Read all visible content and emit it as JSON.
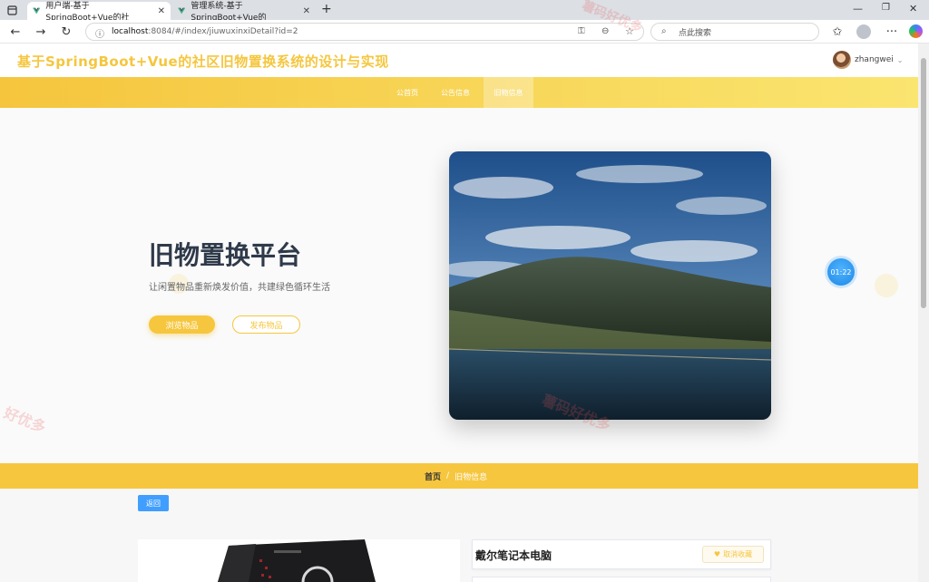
{
  "browser": {
    "tabs": [
      {
        "label": "用户端-基于SpringBoot+Vue的社",
        "active": true
      },
      {
        "label": "管理系统-基于SpringBoot+Vue的",
        "active": false
      }
    ],
    "url_host": "localhost",
    "url_path": ":8084/#/index/jiuwuxinxiDetail?id=2",
    "search_placeholder": "点此搜索",
    "new_tab": "+"
  },
  "header": {
    "site_title": "基于SpringBoot+Vue的社区旧物置换系统的设计与实现",
    "username": "zhangwei"
  },
  "nav": {
    "items": [
      {
        "label": "公首页",
        "active": false
      },
      {
        "label": "公告信息",
        "active": false
      },
      {
        "label": "旧物信息",
        "active": true
      }
    ]
  },
  "hero": {
    "title": "旧物置换平台",
    "subtitle": "让闲置物品重新焕发价值，共建绿色循环生活",
    "browse_label": "浏览物品",
    "publish_label": "发布物品"
  },
  "timer": "01:22",
  "watermarks": [
    "薯码好优多",
    "薯码好优多",
    "好优多"
  ],
  "breadcrumb": {
    "home": "首页",
    "separator": "/",
    "current": "旧物信息"
  },
  "detail": {
    "back_label": "返回",
    "item_title": "戴尔笔记本电脑",
    "unfavorite_label": "取消收藏"
  },
  "colors": {
    "accent": "#f6c63e",
    "back_button": "#409eff",
    "title_text": "#2f3a4a"
  }
}
